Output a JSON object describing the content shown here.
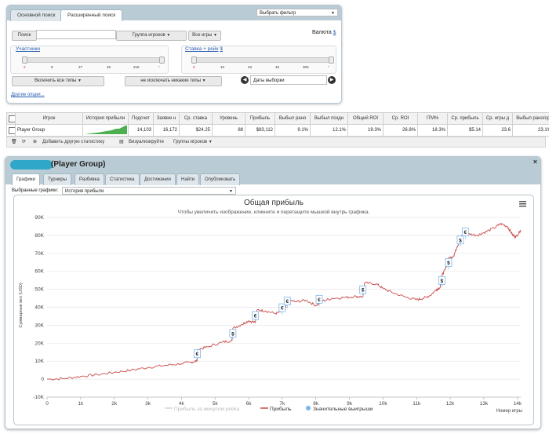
{
  "search": {
    "tabs": [
      {
        "label": "Основной поиск"
      },
      {
        "label": "Расширенный поиск"
      }
    ],
    "filter_select": "Выбрать фильтр",
    "search_button": "Поиск",
    "search_placeholder": "",
    "player_group_button": "Группа игроков",
    "all_games_button": "Все игры",
    "currency_label": "Валюта",
    "currency_value": "$",
    "participants_label": "Участники",
    "participants_ticks": [
      "2",
      "9",
      "27",
      "45",
      "216",
      "*"
    ],
    "buyin_label": "Ставка + рейк",
    "buyin_currency": "$",
    "buyin_ticks": [
      "0",
      "10",
      "23",
      "45",
      "300",
      "*"
    ],
    "include_types": "Включить все типы",
    "exclude_types": "не исключать никакие типы",
    "dates_label": "Даты выборки",
    "other_options": "Другие опции..."
  },
  "stats": {
    "headers": [
      "Игрок",
      "История прибыли",
      "Подсчет",
      "Заявки н",
      "Ср. ставка",
      "Уровень",
      "Прибыль",
      "Выбыл рано",
      "Выбыл поздн",
      "Общий ROI",
      "Ср. ROI",
      "ITM%",
      "Ср. прибыль",
      "Ср. игры д",
      "Выбыл рано/ср"
    ],
    "row": [
      "Player Group",
      "",
      "14,103",
      "16,172",
      "$24.25",
      "88",
      "$83,112",
      "9.1%",
      "12.1%",
      "19.3%",
      "26.8%",
      "18.3%",
      "$5.14",
      "23.6",
      "23.1%"
    ],
    "footer": {
      "add_stat": "Добавить другую статистику",
      "visualize": "Визуализируйте",
      "player_groups": "Группы игроков"
    }
  },
  "graph_panel": {
    "title": "(Player Group)",
    "tabs": [
      {
        "label": "Графики"
      },
      {
        "label": "Турниры"
      },
      {
        "label": "Разбивка"
      },
      {
        "label": "Статистика"
      },
      {
        "label": "Достижения"
      },
      {
        "label": "Найти"
      },
      {
        "label": "Опубликовать"
      }
    ],
    "selected_graphs_label": "Выбранные графики:",
    "selected_graph_value": "История прибыли"
  },
  "chart_data": {
    "type": "line",
    "title": "Общая прибыль",
    "subtitle": "Чтобы увеличить изображение, кликните и перетащите мышкой внутрь графика.",
    "xlabel": "Номер игры",
    "ylabel": "Суммарные вкл (USD)",
    "x_ticks": [
      "0",
      "1k",
      "2k",
      "3k",
      "4k",
      "5k",
      "6k",
      "7k",
      "8k",
      "9k",
      "10k",
      "11k",
      "12k",
      "13k",
      "14k"
    ],
    "y_ticks": [
      "-10K",
      "0",
      "10K",
      "20K",
      "30K",
      "40K",
      "50K",
      "60K",
      "70K",
      "80K",
      "90K"
    ],
    "xlim": [
      0,
      14100
    ],
    "ylim": [
      -10000,
      90000
    ],
    "legend": [
      "Прибыль за минусом рейка",
      "Прибыль",
      "Значительные выигрыши"
    ],
    "series": [
      {
        "name": "Прибыль",
        "color": "#c94a4a",
        "points": [
          [
            0,
            0
          ],
          [
            500,
            300
          ],
          [
            1000,
            1500
          ],
          [
            1500,
            2500
          ],
          [
            2000,
            3800
          ],
          [
            2500,
            5000
          ],
          [
            3000,
            6500
          ],
          [
            3500,
            7600
          ],
          [
            4000,
            8600
          ],
          [
            4300,
            9500
          ],
          [
            4470,
            10200
          ],
          [
            4480,
            16500
          ],
          [
            4800,
            18000
          ],
          [
            5200,
            20500
          ],
          [
            5500,
            21500
          ],
          [
            5530,
            28200
          ],
          [
            5800,
            30500
          ],
          [
            6000,
            32500
          ],
          [
            6200,
            31500
          ],
          [
            6250,
            38500
          ],
          [
            6500,
            38000
          ],
          [
            6800,
            36500
          ],
          [
            7000,
            37800
          ],
          [
            7100,
            39500
          ],
          [
            7150,
            44200
          ],
          [
            7400,
            43000
          ],
          [
            7700,
            44000
          ],
          [
            8000,
            41000
          ],
          [
            8200,
            43500
          ],
          [
            8500,
            45000
          ],
          [
            8900,
            45500
          ],
          [
            9200,
            46000
          ],
          [
            9400,
            45800
          ],
          [
            9450,
            53500
          ],
          [
            9800,
            53000
          ],
          [
            10000,
            50500
          ],
          [
            10300,
            48000
          ],
          [
            10700,
            45500
          ],
          [
            11000,
            44200
          ],
          [
            11200,
            45000
          ],
          [
            11400,
            46500
          ],
          [
            11600,
            50000
          ],
          [
            11700,
            51000
          ],
          [
            11750,
            57500
          ],
          [
            11850,
            61000
          ],
          [
            11950,
            67000
          ],
          [
            12100,
            68500
          ],
          [
            12200,
            73500
          ],
          [
            12300,
            77500
          ],
          [
            12400,
            82500
          ],
          [
            12500,
            81000
          ],
          [
            12800,
            80000
          ],
          [
            13000,
            81500
          ],
          [
            13300,
            84000
          ],
          [
            13500,
            86500
          ],
          [
            13700,
            85000
          ],
          [
            13850,
            80500
          ],
          [
            13950,
            79000
          ],
          [
            14100,
            83000
          ]
        ]
      }
    ],
    "big_wins": [
      {
        "x": 4470,
        "y": 10200,
        "currency": "€"
      },
      {
        "x": 5530,
        "y": 21500,
        "currency": "$"
      },
      {
        "x": 6200,
        "y": 31500,
        "currency": "€"
      },
      {
        "x": 7000,
        "y": 35800,
        "currency": "€"
      },
      {
        "x": 7150,
        "y": 39500,
        "currency": "€"
      },
      {
        "x": 8100,
        "y": 40500,
        "currency": "€"
      },
      {
        "x": 9400,
        "y": 45800,
        "currency": "$"
      },
      {
        "x": 11750,
        "y": 51000,
        "currency": "$"
      },
      {
        "x": 11950,
        "y": 61000,
        "currency": "$"
      },
      {
        "x": 12300,
        "y": 73500,
        "currency": "$"
      },
      {
        "x": 12450,
        "y": 78000,
        "currency": "€"
      }
    ],
    "colors": {
      "profit": "#c94a4a",
      "rake": "#d6d6d6",
      "bigwin": "#7cb5ec"
    }
  }
}
